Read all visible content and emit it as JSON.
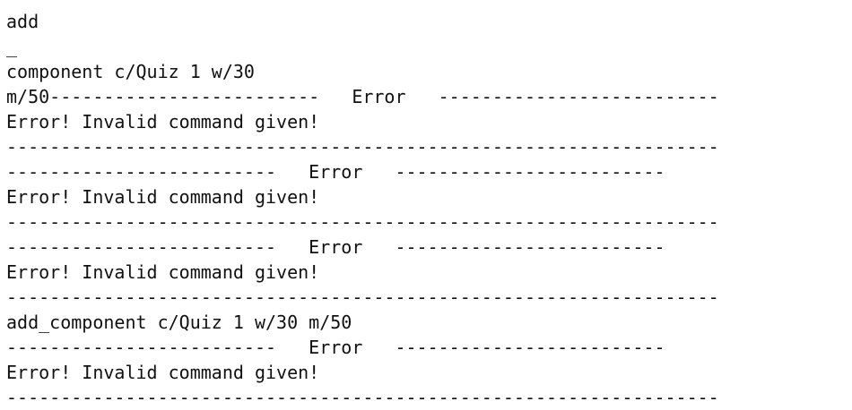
{
  "terminal": {
    "lines": [
      "add",
      "_",
      "component c/Quiz 1 w/30",
      "m/50-------------------------   Error   --------------------------",
      "Error! Invalid command given!",
      "------------------------------------------------------------------",
      "-------------------------   Error   -------------------------",
      "Error! Invalid command given!",
      "------------------------------------------------------------------",
      "-------------------------   Error   -------------------------",
      "Error! Invalid command given!",
      "------------------------------------------------------------------",
      "add_component c/Quiz 1 w/30 m/50",
      "-------------------------   Error   -------------------------",
      "Error! Invalid command given!",
      "------------------------------------------------------------------"
    ]
  }
}
